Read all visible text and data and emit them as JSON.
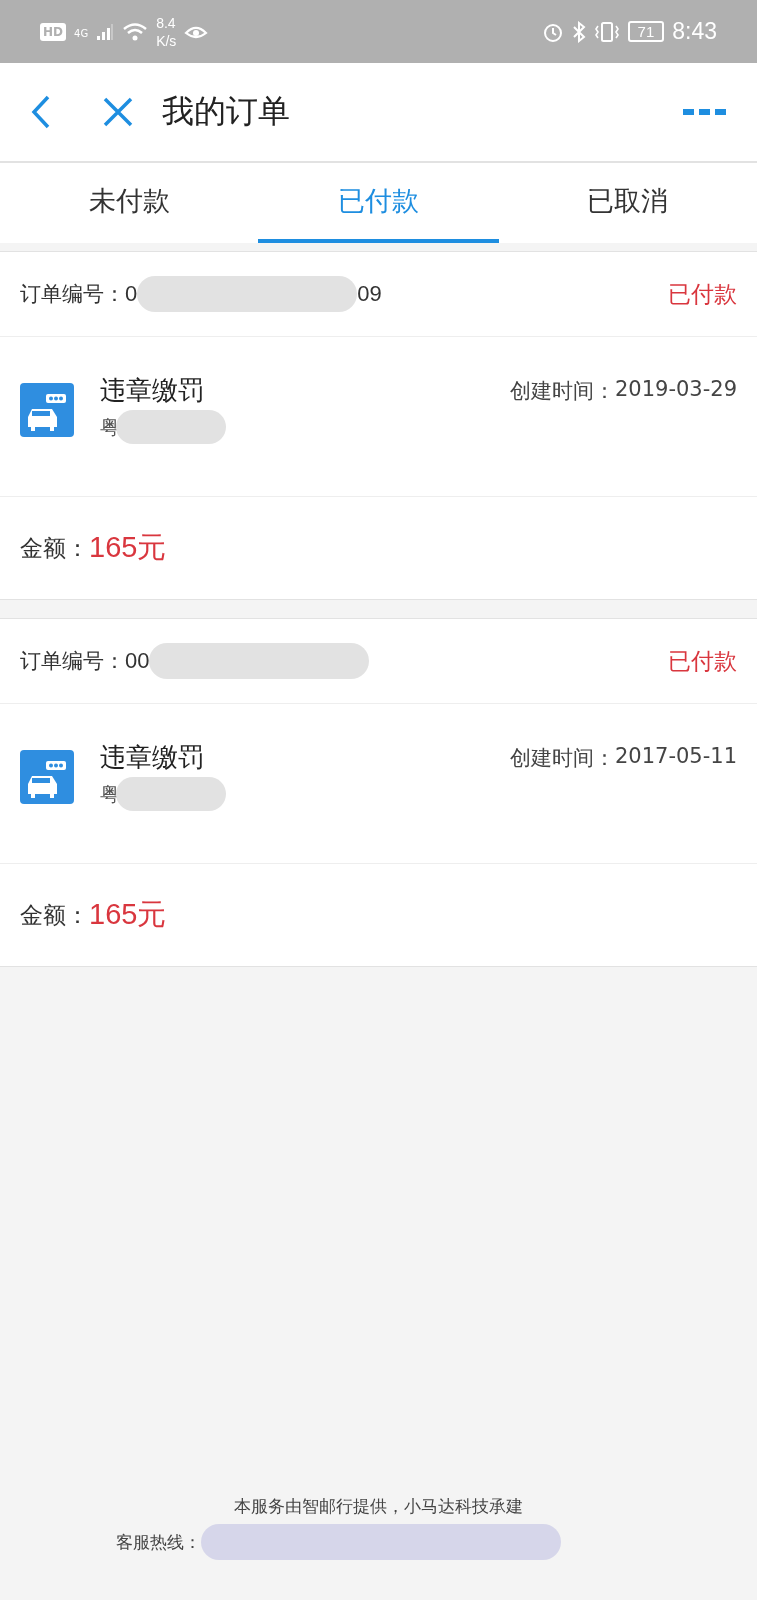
{
  "status_bar": {
    "hd": "HD",
    "network": "4G",
    "speed_value": "8.4",
    "speed_unit": "K/s",
    "battery": "71",
    "time": "8:43"
  },
  "header": {
    "title": "我的订单"
  },
  "tabs": [
    {
      "label": "未付款",
      "selected": false
    },
    {
      "label": "已付款",
      "selected": true
    },
    {
      "label": "已取消",
      "selected": false
    }
  ],
  "orders": [
    {
      "number_label": "订单编号：",
      "number_start": "0",
      "number_end": "09",
      "status": "已付款",
      "service": "违章缴罚",
      "plate": "粤",
      "created_label": "创建时间：",
      "created": "2019-03-29",
      "amount_label": "金额：",
      "amount": "165元"
    },
    {
      "number_label": "订单编号：",
      "number_start": "00",
      "status": "已付款",
      "service": "违章缴罚",
      "plate": "粤",
      "created_label": "创建时间：",
      "created": "2017-05-11",
      "amount_label": "金额：",
      "amount": "165元"
    }
  ],
  "footer": {
    "credit": "本服务由智邮行提供，小马达科技承建",
    "hotline_label": "客服热线："
  }
}
